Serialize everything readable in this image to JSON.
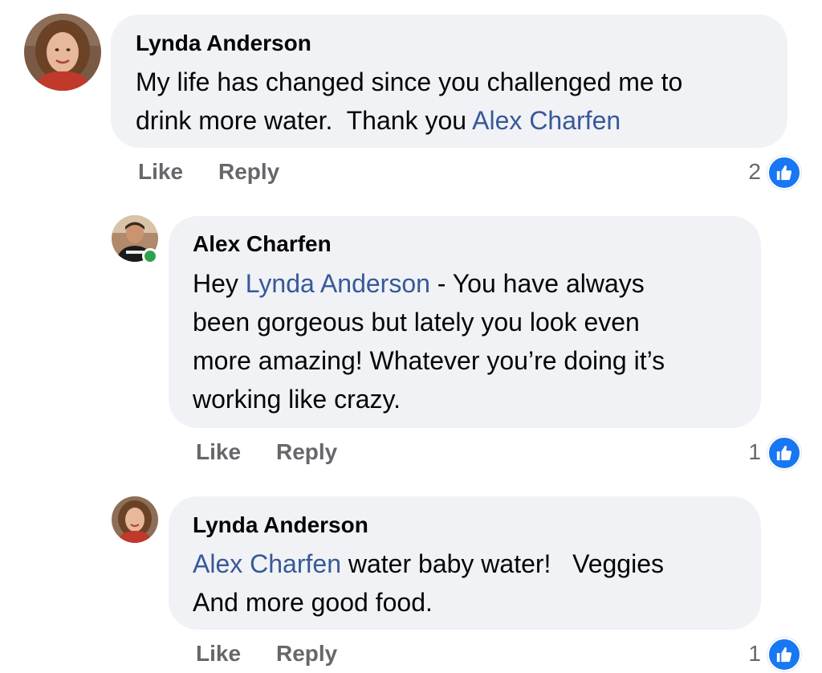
{
  "colors": {
    "bubble": "#f0f2f5",
    "mention": "#385898",
    "action_text": "#65676b",
    "like_blue": "#1877f2",
    "online_green": "#31a24c"
  },
  "comments": [
    {
      "author": "Lynda Anderson",
      "avatar_icon": "profile-photo-lynda",
      "body_line1": "My life has changed since you challenged me to",
      "body_line2_text": "drink more water.  Thank you ",
      "body_line2_mention": "Alex Charfen",
      "like_label": "Like",
      "reply_label": "Reply",
      "reaction_count": "2",
      "reaction_icon": "thumbs-up-icon"
    },
    {
      "author": "Alex Charfen",
      "avatar_icon": "profile-photo-alex",
      "online": true,
      "body_line1_prefix": "Hey ",
      "body_line1_mention": "Lynda Anderson",
      "body_line1_suffix": " - You have always",
      "body_line2": "been gorgeous but lately you look even",
      "body_line3": "more amazing! Whatever you’re doing it’s",
      "body_line4": "working like crazy.",
      "like_label": "Like",
      "reply_label": "Reply",
      "reaction_count": "1",
      "reaction_icon": "thumbs-up-icon"
    },
    {
      "author": "Lynda Anderson",
      "avatar_icon": "profile-photo-lynda",
      "body_line1_mention": "Alex Charfen",
      "body_line1_suffix": " water baby water!   Veggies",
      "body_line2": "And more good food.",
      "like_label": "Like",
      "reply_label": "Reply",
      "reaction_count": "1",
      "reaction_icon": "thumbs-up-icon"
    }
  ]
}
